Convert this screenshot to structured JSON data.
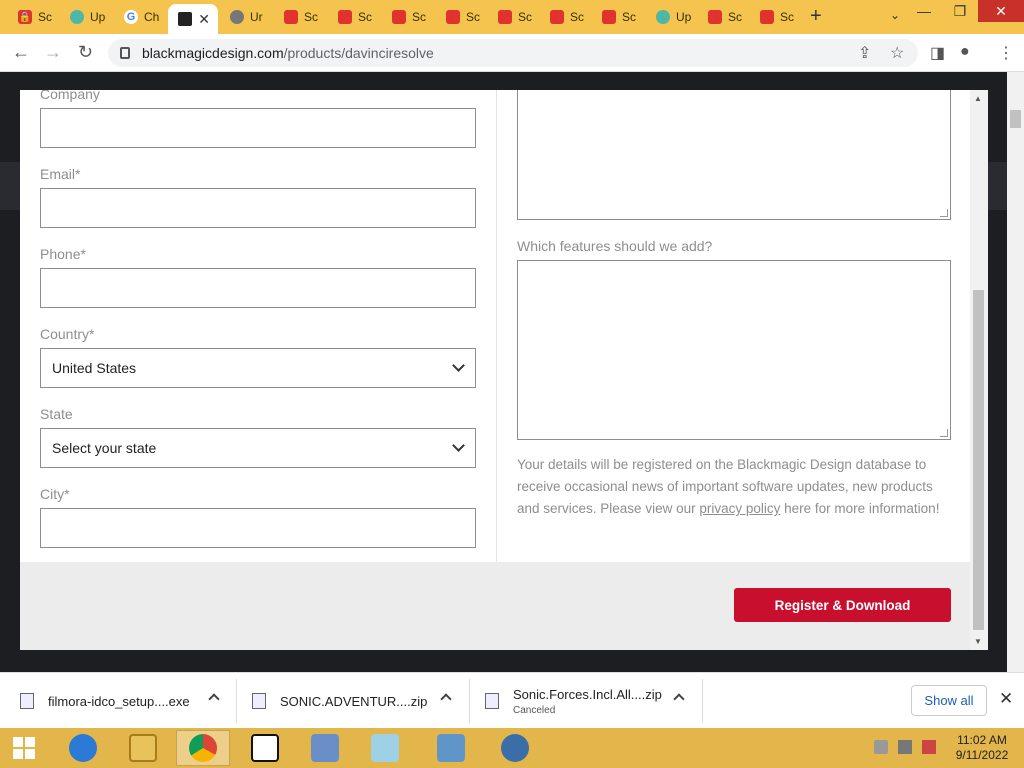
{
  "browser": {
    "tabs": [
      {
        "label": "Sc",
        "icon": "lock-red-icon"
      },
      {
        "label": "Up",
        "icon": "teal-logo-icon"
      },
      {
        "label": "Ch",
        "icon": "google-icon"
      },
      {
        "label": "",
        "icon": "blackmagic-icon",
        "active": true
      },
      {
        "label": "Ur",
        "icon": "globe-icon"
      },
      {
        "label": "Sc",
        "icon": "lock-red-icon"
      },
      {
        "label": "Sc",
        "icon": "lock-red-icon"
      },
      {
        "label": "Sc",
        "icon": "lock-red-icon"
      },
      {
        "label": "Sc",
        "icon": "lock-red-icon"
      },
      {
        "label": "Sc",
        "icon": "lock-red-icon"
      },
      {
        "label": "Sc",
        "icon": "lock-red-icon"
      },
      {
        "label": "Sc",
        "icon": "lock-red-icon"
      },
      {
        "label": "Up",
        "icon": "teal-logo-icon"
      },
      {
        "label": "Sc",
        "icon": "lock-red-icon"
      },
      {
        "label": "Sc",
        "icon": "lock-red-icon"
      }
    ],
    "url_domain": "blackmagicdesign.com",
    "url_path": "/products/davinciresolve"
  },
  "form": {
    "company_label": "Company",
    "email_label": "Email*",
    "phone_label": "Phone*",
    "country_label": "Country*",
    "country_value": "United States",
    "state_label": "State",
    "state_value": "Select your state",
    "city_label": "City*",
    "features_label": "Which features should we add?",
    "notice_before": "Your details will be registered on the Blackmagic Design database to receive occasional news of important software updates, new products and services. Please view our ",
    "notice_link": "privacy policy",
    "notice_after": " here for more information!",
    "submit_label": "Register & Download"
  },
  "downloads": {
    "items": [
      {
        "name": "filmora-idco_setup....exe",
        "status": ""
      },
      {
        "name": "SONIC.ADVENTUR....zip",
        "status": ""
      },
      {
        "name": "Sonic.Forces.Incl.All....zip",
        "status": "Canceled"
      }
    ],
    "show_all": "Show all"
  },
  "taskbar": {
    "time": "11:02 AM",
    "date": "9/11/2022"
  },
  "colors": {
    "accent": "#c8102e",
    "tabstrip": "#f4c44f",
    "taskbar": "#e3b64b"
  }
}
